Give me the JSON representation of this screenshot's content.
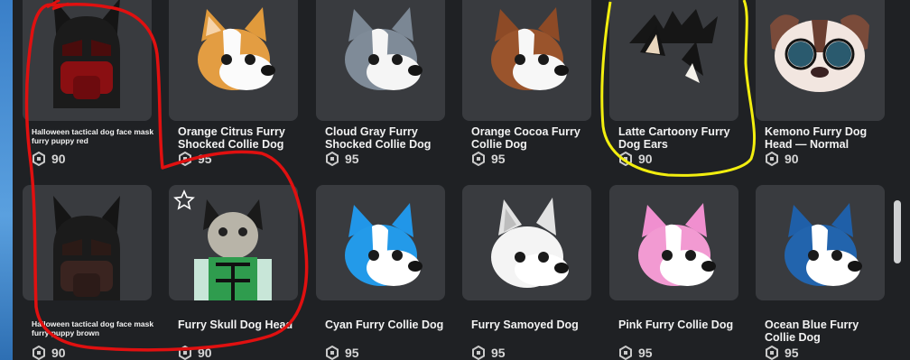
{
  "currency_icon": "robux-icon",
  "accent": "#ffffff",
  "items": [
    {
      "name": "Halloween tactical dog face mask furry puppy red",
      "price": "90",
      "icon": "tactical-dog-mask-red-icon"
    },
    {
      "name": "Orange Citrus Furry Shocked Collie Dog",
      "price": "95",
      "icon": "orange-collie-dog-head-icon"
    },
    {
      "name": "Cloud Gray Furry Shocked Collie Dog",
      "price": "95",
      "icon": "gray-collie-dog-head-icon"
    },
    {
      "name": "Orange Cocoa Furry Collie Dog",
      "price": "95",
      "icon": "cocoa-collie-dog-head-icon"
    },
    {
      "name": "Latte Cartoony Furry Dog Ears",
      "price": "90",
      "icon": "dog-ears-icon"
    },
    {
      "name": "Kemono Furry Dog Head — Normal",
      "price": "90",
      "icon": "kemono-dog-head-icon"
    },
    {
      "name": "Halloween tactical dog face mask furry puppy brown",
      "price": "90",
      "icon": "tactical-dog-mask-brown-icon"
    },
    {
      "name": "Furry Skull Dog Head",
      "price": "90",
      "icon": "skull-dog-avatar-icon"
    },
    {
      "name": "Cyan Furry Collie Dog",
      "price": "95",
      "icon": "cyan-collie-dog-head-icon"
    },
    {
      "name": "Furry Samoyed Dog",
      "price": "95",
      "icon": "samoyed-dog-head-icon"
    },
    {
      "name": "Pink Furry Collie Dog",
      "price": "95",
      "icon": "pink-collie-dog-head-icon"
    },
    {
      "name": "Ocean Blue Furry Collie Dog",
      "price": "95",
      "icon": "ocean-blue-collie-dog-head-icon"
    }
  ],
  "annotations": {
    "red": "#e01010",
    "yellow": "#f2ee0f"
  }
}
